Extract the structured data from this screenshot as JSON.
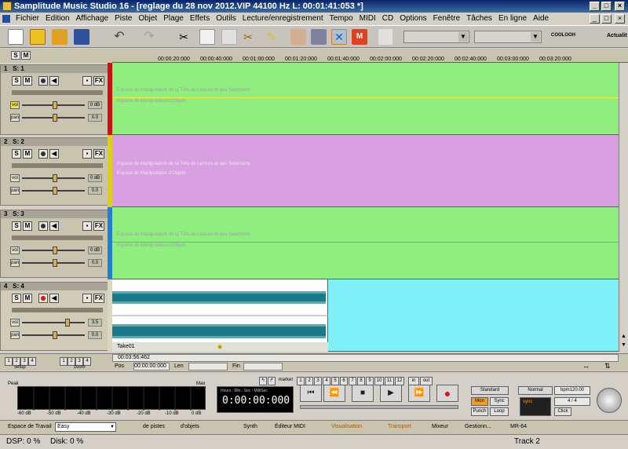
{
  "window": {
    "title": "Samplitude Music Studio 16 - [reglage du 28 nov 2012.VIP   44100 Hz L: 00:01:41:053 *]"
  },
  "menu": [
    "Fichier",
    "Edition",
    "Affichage",
    "Piste",
    "Objet",
    "Plage",
    "Effets",
    "Outils",
    "Lecture/enregistrement",
    "Tempo",
    "MIDI",
    "CD",
    "Options",
    "Fenêtre",
    "Tâches",
    "En ligne",
    "Aide"
  ],
  "toolbar": {
    "brand": "COOLOOH",
    "actualites": "Actualit"
  },
  "ruler": {
    "sm": [
      "S",
      "M"
    ],
    "ticks": [
      "00:00:20:000",
      "00:00:40:000",
      "00:01:00:000",
      "00:01:20:000",
      "00:01:40:000",
      "00:02:00:000",
      "00:02:20:000",
      "00:02:40:000",
      "00:03:00:000",
      "00:03:20:000"
    ]
  },
  "tracks": [
    {
      "num": "1",
      "label": "S: 1",
      "vol": "0 dB",
      "pan": "0.0",
      "color": "#90ee80",
      "strip": "#d01010",
      "lane_text_1": "Espace de Manipulation de la Tête de Lecture et des Sélections",
      "lane_text_2": "Espace de Manipulation d'Objets",
      "rec": "#303030"
    },
    {
      "num": "2",
      "label": "S: 2",
      "vol": "0 dB",
      "pan": "0.0",
      "color": "#d8a0e0",
      "strip": "#e0d010",
      "lane_text_1": "Espace de Manipulation de la Tête de Lecture et des Sélections",
      "lane_text_2": "Espace de Manipulation d'Objets",
      "rec": "#303030"
    },
    {
      "num": "3",
      "label": "S: 3",
      "vol": "0 dB",
      "pan": "0.0",
      "color": "#90ee80",
      "strip": "#2080d0",
      "lane_text_1": "Espace de Manipulation de la Tête de Lecture et des Sélections",
      "lane_text_2": "Espace de Manipulation d'Objets",
      "rec": "#303030"
    },
    {
      "num": "4",
      "label": "S: 4",
      "vol": "3.5",
      "pan": "0.0",
      "color": "#80f0f8",
      "strip": "#d8d8c0",
      "object_name": "Take01",
      "rec": "#e01010"
    }
  ],
  "trackbuttons": {
    "s": "S",
    "m": "M",
    "fx": "FX",
    "vol": "vol",
    "pan": "pan"
  },
  "bottom": {
    "setup_label": "setup",
    "zoom_label": "zoom",
    "setup_nums": [
      "1",
      "2",
      "3",
      "4"
    ],
    "zoom_nums": [
      "1",
      "2",
      "3",
      "4"
    ],
    "time_display": "00:03:56:462",
    "pos_label": "Pos",
    "pos_value": "00:00:00:000",
    "len_label": "Len",
    "fin_label": "Fin"
  },
  "meter": {
    "peak": "Peak",
    "max": "Max",
    "scale": [
      "-60 dB",
      "-50 dB",
      "-40 dB",
      "-30 dB",
      "-20 dB",
      "-10 dB",
      "0 dB"
    ]
  },
  "transport": {
    "header": "Hours : Min : Sec : MilliSec",
    "time": "0:00:00:000",
    "marker_label": "marker",
    "marker_nums": [
      "1",
      "2",
      "3",
      "4",
      "5",
      "6",
      "7",
      "8",
      "9",
      "10",
      "11",
      "12"
    ],
    "in": "in",
    "out": "out",
    "standard": "Standard",
    "mon": "Mon",
    "sync": "Sync",
    "punch": "Punch",
    "loop": "Loop",
    "normal": "Normal",
    "bpm": "bpm120.00",
    "signature": "4 / 4",
    "click": "Click",
    "sync_badge": "sync"
  },
  "workspace": {
    "label": "Espace de Travail",
    "value": "Easy",
    "items": [
      "de pistes",
      "d'objets",
      "Synth",
      "Éditeur MIDI",
      "Visualisation",
      "Transport",
      "Mixeur",
      "Gestionn...",
      "MR-64"
    ],
    "track": "Track 2"
  },
  "status": {
    "dsp": "DSP: 0 %",
    "disk": "Disk: 0 %"
  }
}
